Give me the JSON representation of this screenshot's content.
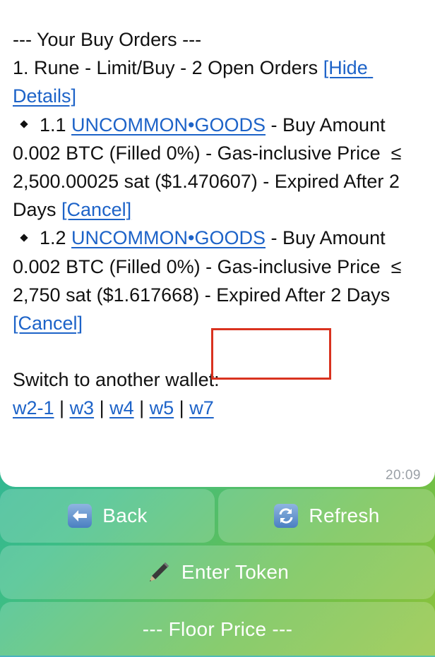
{
  "message": {
    "header": "--- Your Buy Orders ---",
    "order1_line": "1. Rune - Limit/Buy - 2 Open Orders ",
    "hide_details_link": "[Hide Details]",
    "sub1": {
      "index": "1.1 ",
      "token_link": "UNCOMMON•GOODS",
      "text": " - Buy Amount  0.002 BTC (Filled 0%) - Gas-inclusive Price  ≤ 2,500.00025 sat ($1.470607) - Expired After 2 Days ",
      "cancel_link": "[Cancel]"
    },
    "sub2": {
      "index": "1.2 ",
      "token_link": "UNCOMMON•GOODS",
      "text": " - Buy Amount  0.002 BTC (Filled 0%) - Gas-inclusive Price  ≤ 2,750 sat ($1.617668) - Expired After 2 Days ",
      "cancel_link": "[Cancel]"
    },
    "switch_label": "Switch to another wallet:",
    "wallets": [
      "w2-1",
      "w3",
      "w4",
      "w5",
      "w7"
    ],
    "separator": " | ",
    "time": "20:09"
  },
  "keyboard": {
    "back": {
      "label": "Back",
      "icon": "back-arrow-icon"
    },
    "refresh": {
      "label": "Refresh",
      "icon": "refresh-icon"
    },
    "enter_token": {
      "label": "Enter Token",
      "icon": "pen-icon"
    },
    "floor_price": {
      "label": "--- Floor Price ---"
    }
  },
  "colors": {
    "link": "#1d63c8",
    "highlight": "#d9321f"
  }
}
